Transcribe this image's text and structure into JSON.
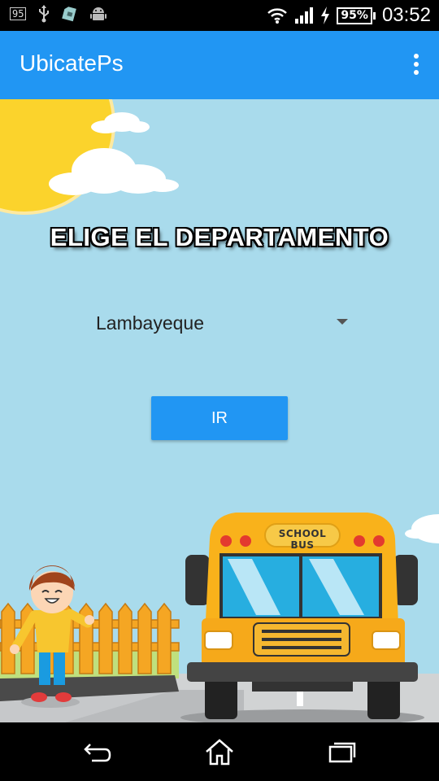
{
  "status_bar": {
    "notif_badge": "95",
    "battery": "95%",
    "time": "03:52",
    "icons": [
      "notification-95-icon",
      "usb-icon",
      "sim-card-icon",
      "android-icon",
      "wifi-icon",
      "signal-icon",
      "charging-icon",
      "battery-icon"
    ]
  },
  "app_bar": {
    "title": "UbicatePs",
    "menu_icon": "overflow-menu-icon"
  },
  "main": {
    "heading": "ELIGE EL DEPARTAMENTO",
    "department_select": {
      "selected": "Lambayeque",
      "arrow_icon": "dropdown-arrow-icon"
    },
    "go_button": "IR",
    "illustration": {
      "bus_sign": "SCHOOL BUS"
    }
  },
  "nav_bar": {
    "icons": [
      "back-icon",
      "home-icon",
      "recents-icon"
    ]
  },
  "colors": {
    "primary": "#2196f3",
    "sky": "#a9dbec",
    "sun": "#fbd32c",
    "bus": "#f9b21b"
  }
}
